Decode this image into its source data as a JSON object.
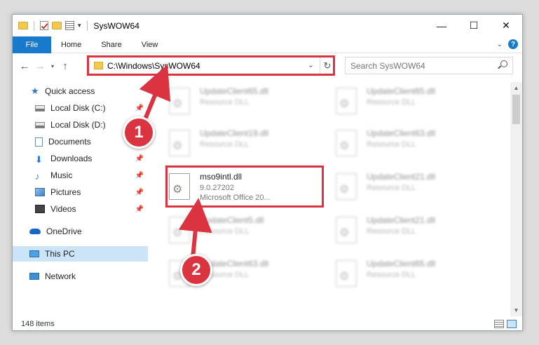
{
  "window": {
    "title": "SysWOW64",
    "buttons": {
      "minimize": "—",
      "maximize": "☐",
      "close": "✕"
    }
  },
  "ribbon": {
    "tabs": [
      "File",
      "Home",
      "Share",
      "View"
    ],
    "help_label": "?"
  },
  "address": {
    "path": "C:\\Windows\\SysWOW64",
    "search_placeholder": "Search SysWOW64"
  },
  "nav": {
    "items": [
      {
        "label": "Quick access",
        "icon": "star-icon",
        "pinned": false
      },
      {
        "label": "Local Disk (C:)",
        "icon": "disk-icon",
        "pinned": true
      },
      {
        "label": "Local Disk (D:)",
        "icon": "disk-icon",
        "pinned": false
      },
      {
        "label": "Documents",
        "icon": "documents-icon",
        "pinned": true
      },
      {
        "label": "Downloads",
        "icon": "download-icon",
        "pinned": true
      },
      {
        "label": "Music",
        "icon": "music-icon",
        "pinned": true
      },
      {
        "label": "Pictures",
        "icon": "pictures-icon",
        "pinned": true
      },
      {
        "label": "Videos",
        "icon": "videos-icon",
        "pinned": true
      },
      {
        "label": "OneDrive",
        "icon": "onedrive-icon",
        "pinned": false
      },
      {
        "label": "This PC",
        "icon": "pc-icon",
        "pinned": false,
        "selected": true
      },
      {
        "label": "Network",
        "icon": "network-icon",
        "pinned": false
      }
    ]
  },
  "files": {
    "left": [
      {
        "name": "UpdateClient65.dll",
        "sub1": "Resource DLL"
      },
      {
        "name": "UpdateClient19.dll",
        "sub1": "Resource DLL"
      },
      {
        "name": "mso9intl.dll",
        "sub1": "9.0.27202",
        "sub2": "Microsoft Office 20...",
        "highlighted": true
      },
      {
        "name": "UpdateClient5.dll",
        "sub1": "Resource DLL"
      },
      {
        "name": "UpdateClient63.dll",
        "sub1": "Resource DLL"
      }
    ],
    "right": [
      {
        "name": "UpdateClient65.dll",
        "sub1": "Resource DLL"
      },
      {
        "name": "UpdateClient63.dll",
        "sub1": "Resource DLL"
      },
      {
        "name": "UpdateClient21.dll",
        "sub1": "Resource DLL"
      },
      {
        "name": "UpdateClient21.dll",
        "sub1": "Resource DLL"
      },
      {
        "name": "UpdateClient65.dll",
        "sub1": "Resource DLL"
      }
    ]
  },
  "status": {
    "count": "148 items"
  },
  "callouts": {
    "step1": "1",
    "step2": "2"
  },
  "colors": {
    "accent": "#1979ca",
    "highlight": "#d93440",
    "selection": "#cce4f7"
  }
}
